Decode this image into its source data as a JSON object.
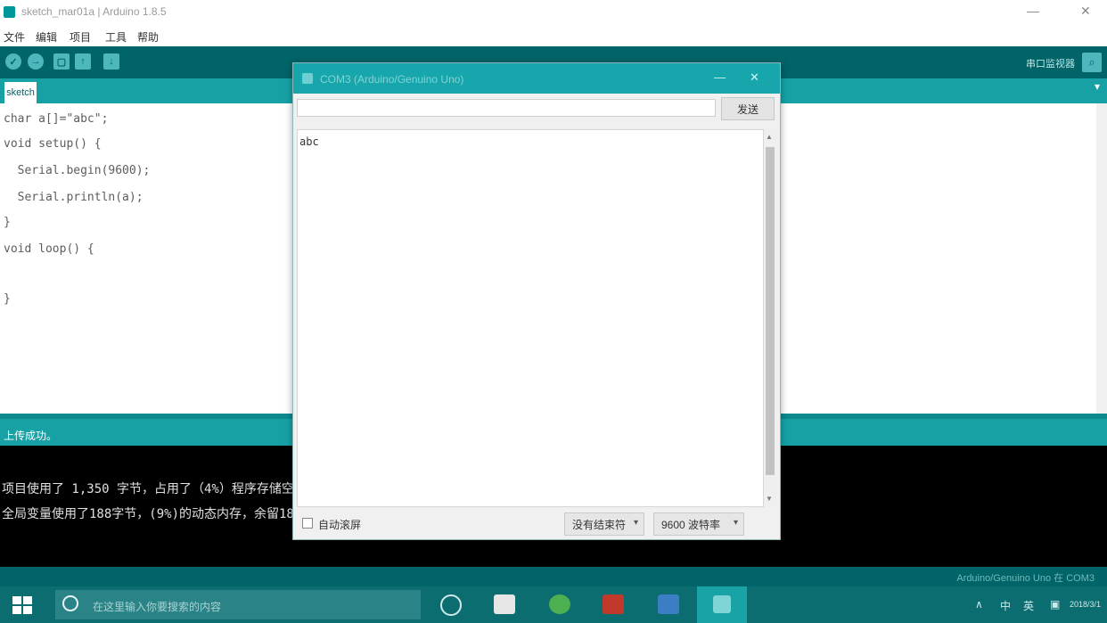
{
  "window": {
    "title": "sketch_mar01a | Arduino 1.8.5",
    "minimize": "—",
    "close": "✕"
  },
  "menu": [
    "文件",
    "编辑",
    "项目",
    "工具",
    "帮助"
  ],
  "toolbar": {
    "buttons": [
      "✓",
      "→",
      "▢",
      "↑",
      "↓"
    ],
    "monitor_label": "串口监视器"
  },
  "tab": {
    "name": "sketch",
    "menu_icon": "▾"
  },
  "editor": {
    "lines": [
      "char a[]=\"abc\";",
      "void setup() {",
      "  Serial.begin(9600);",
      "  Serial.println(a);",
      "}",
      "",
      "void loop() {",
      "",
      "}"
    ]
  },
  "status": {
    "text": "上传成功。"
  },
  "console": {
    "lines": [
      "项目使用了 1,350 字节，占用了（4%）程序存储空间。最大为 32,256 字节。",
      "全局变量使用了188字节，(9%)的动态内存，余留1860字节局部变量。最大为2048字节。"
    ]
  },
  "board_info": "Arduino/Genuino Uno 在 COM3",
  "serial_monitor": {
    "title": "COM3 (Arduino/Genuino Uno)",
    "input_value": "",
    "send_label": "发送",
    "output": "abc",
    "autoscroll_label": "自动滚屏",
    "line_ending": "没有结束符",
    "baud": "9600 波特率",
    "minimize": "—",
    "close": "✕"
  },
  "taskbar": {
    "search_placeholder": "在这里输入你要搜索的内容",
    "tray": [
      "∧",
      "中",
      "英",
      "▣",
      "2018/3/1"
    ]
  }
}
